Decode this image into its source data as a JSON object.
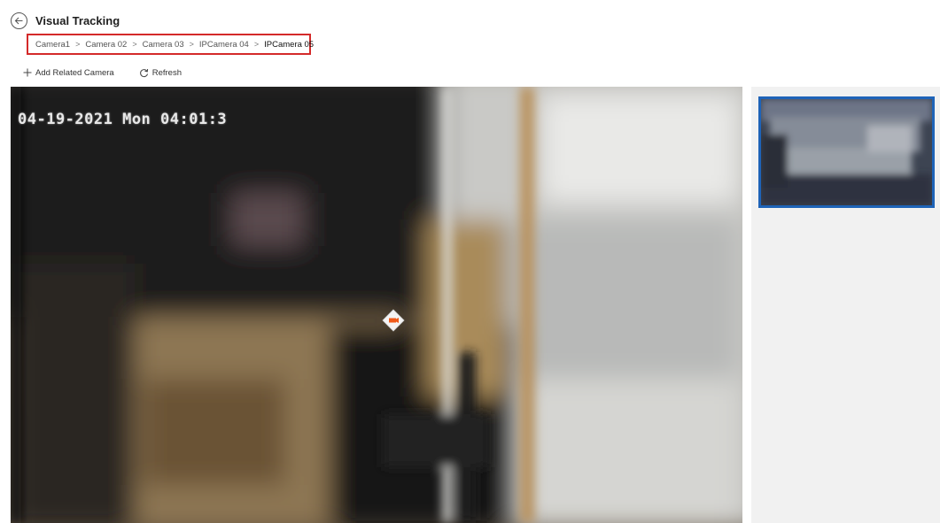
{
  "header": {
    "title": "Visual Tracking",
    "back_icon": "back-arrow-icon"
  },
  "breadcrumb": {
    "items": [
      "Camera1",
      "Camera 02",
      "Camera 03",
      "IPCamera 04",
      "IPCamera 05"
    ],
    "separator": ">",
    "highlight_color": "#d42a2a"
  },
  "toolbar": {
    "add_label": "Add Related Camera",
    "add_icon": "plus-icon",
    "refresh_label": "Refresh",
    "refresh_icon": "refresh-icon"
  },
  "video": {
    "osd_timestamp": "04-19-2021 Mon 04:01:3",
    "marker_icon": "camera-location-icon",
    "marker_color": "#f05a1a"
  },
  "side_panel": {
    "thumbnail_selected": true,
    "selected_border_color": "#1e63b8"
  }
}
